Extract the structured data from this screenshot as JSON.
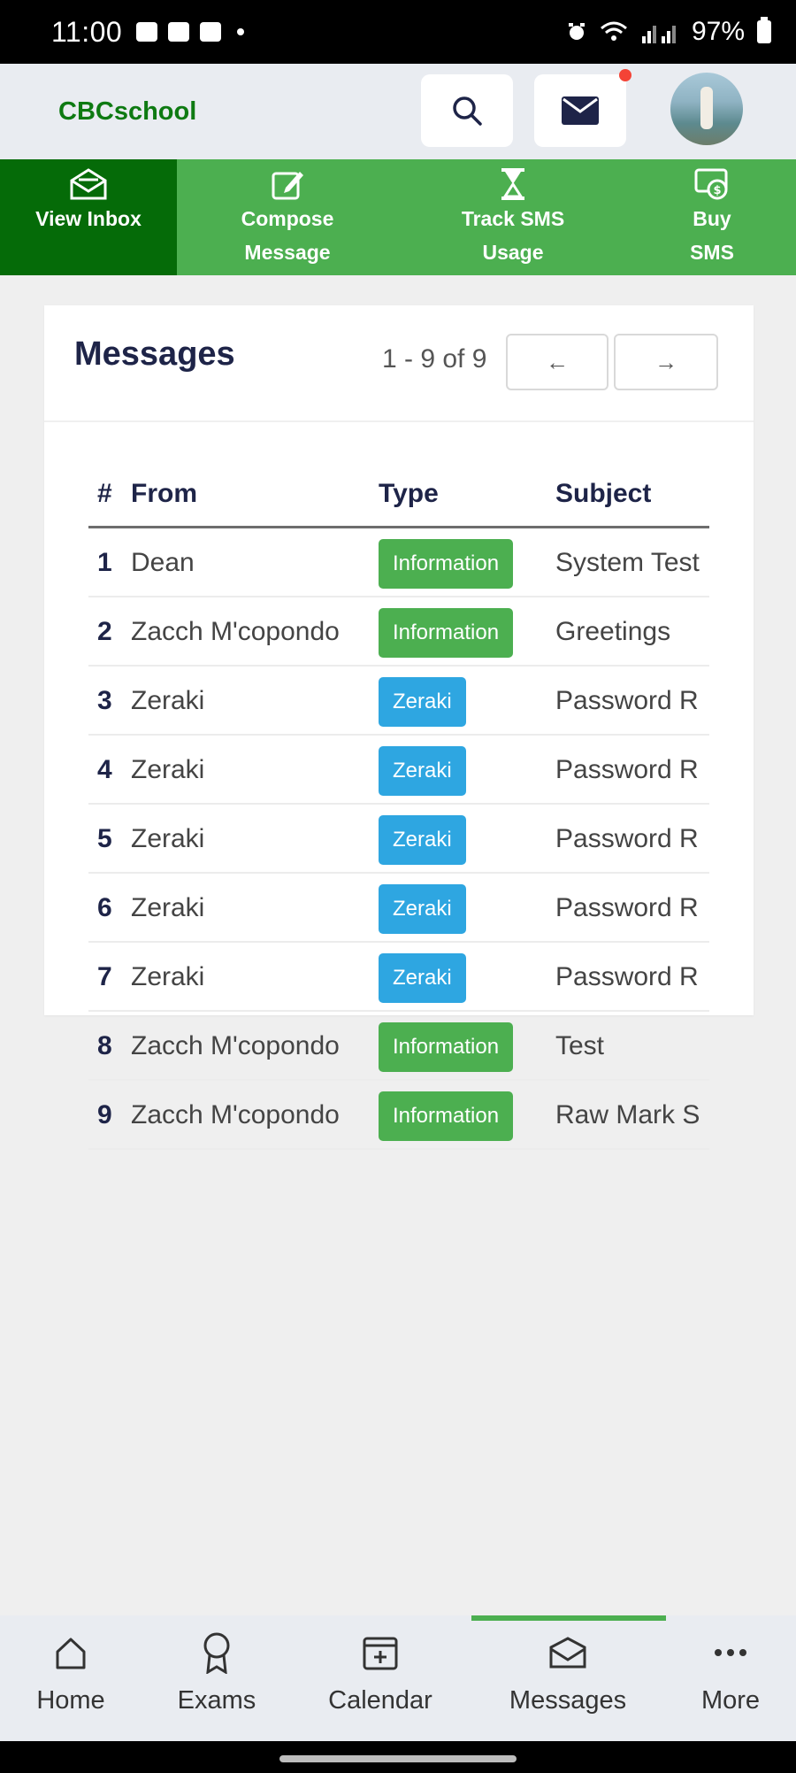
{
  "status_bar": {
    "time": "11:00",
    "battery": "97%"
  },
  "app": {
    "brand": "CBCschool",
    "icons": {
      "search": "search-icon",
      "mail": "mail-icon",
      "avatar": "user-avatar"
    }
  },
  "actions": [
    {
      "label": "View Inbox",
      "icon": "envelope-open-icon",
      "active": true
    },
    {
      "label": "Compose Message",
      "icon": "edit-icon",
      "active": false
    },
    {
      "label": "Track SMS Usage",
      "icon": "hourglass-icon",
      "active": false
    },
    {
      "label": "Buy SMS",
      "icon": "buy-sms-icon",
      "active": false
    }
  ],
  "messages": {
    "title": "Messages",
    "pager": "1 - 9 of 9",
    "prev_label": "←",
    "next_label": "→",
    "columns": {
      "num": "#",
      "from": "From",
      "type": "Type",
      "subject": "Subject"
    },
    "rows": [
      {
        "num": "1",
        "from": "Dean",
        "type": "Information",
        "subject": "System Test"
      },
      {
        "num": "2",
        "from": "Zacch M'copondo",
        "type": "Information",
        "subject": "Greetings"
      },
      {
        "num": "3",
        "from": "Zeraki",
        "type": "Zeraki",
        "subject": "Password R"
      },
      {
        "num": "4",
        "from": "Zeraki",
        "type": "Zeraki",
        "subject": "Password R"
      },
      {
        "num": "5",
        "from": "Zeraki",
        "type": "Zeraki",
        "subject": "Password R"
      },
      {
        "num": "6",
        "from": "Zeraki",
        "type": "Zeraki",
        "subject": "Password R"
      },
      {
        "num": "7",
        "from": "Zeraki",
        "type": "Zeraki",
        "subject": "Password R"
      },
      {
        "num": "8",
        "from": "Zacch M'copondo",
        "type": "Information",
        "subject": "Test"
      },
      {
        "num": "9",
        "from": "Zacch M'copondo",
        "type": "Information",
        "subject": "Raw Mark S"
      }
    ]
  },
  "bottom_nav": [
    {
      "label": "Home",
      "icon": "home-icon",
      "active": false
    },
    {
      "label": "Exams",
      "icon": "award-icon",
      "active": false
    },
    {
      "label": "Calendar",
      "icon": "calendar-icon",
      "active": false
    },
    {
      "label": "Messages",
      "icon": "envelope-icon",
      "active": true
    },
    {
      "label": "More",
      "icon": "more-icon",
      "active": false
    }
  ],
  "colors": {
    "brand_green": "#0e7a12",
    "action_bar": "#4caf50",
    "action_active": "#056b08",
    "badge_information": "#4caf50",
    "badge_zeraki": "#2ea6e1",
    "title_navy": "#1e2448"
  }
}
